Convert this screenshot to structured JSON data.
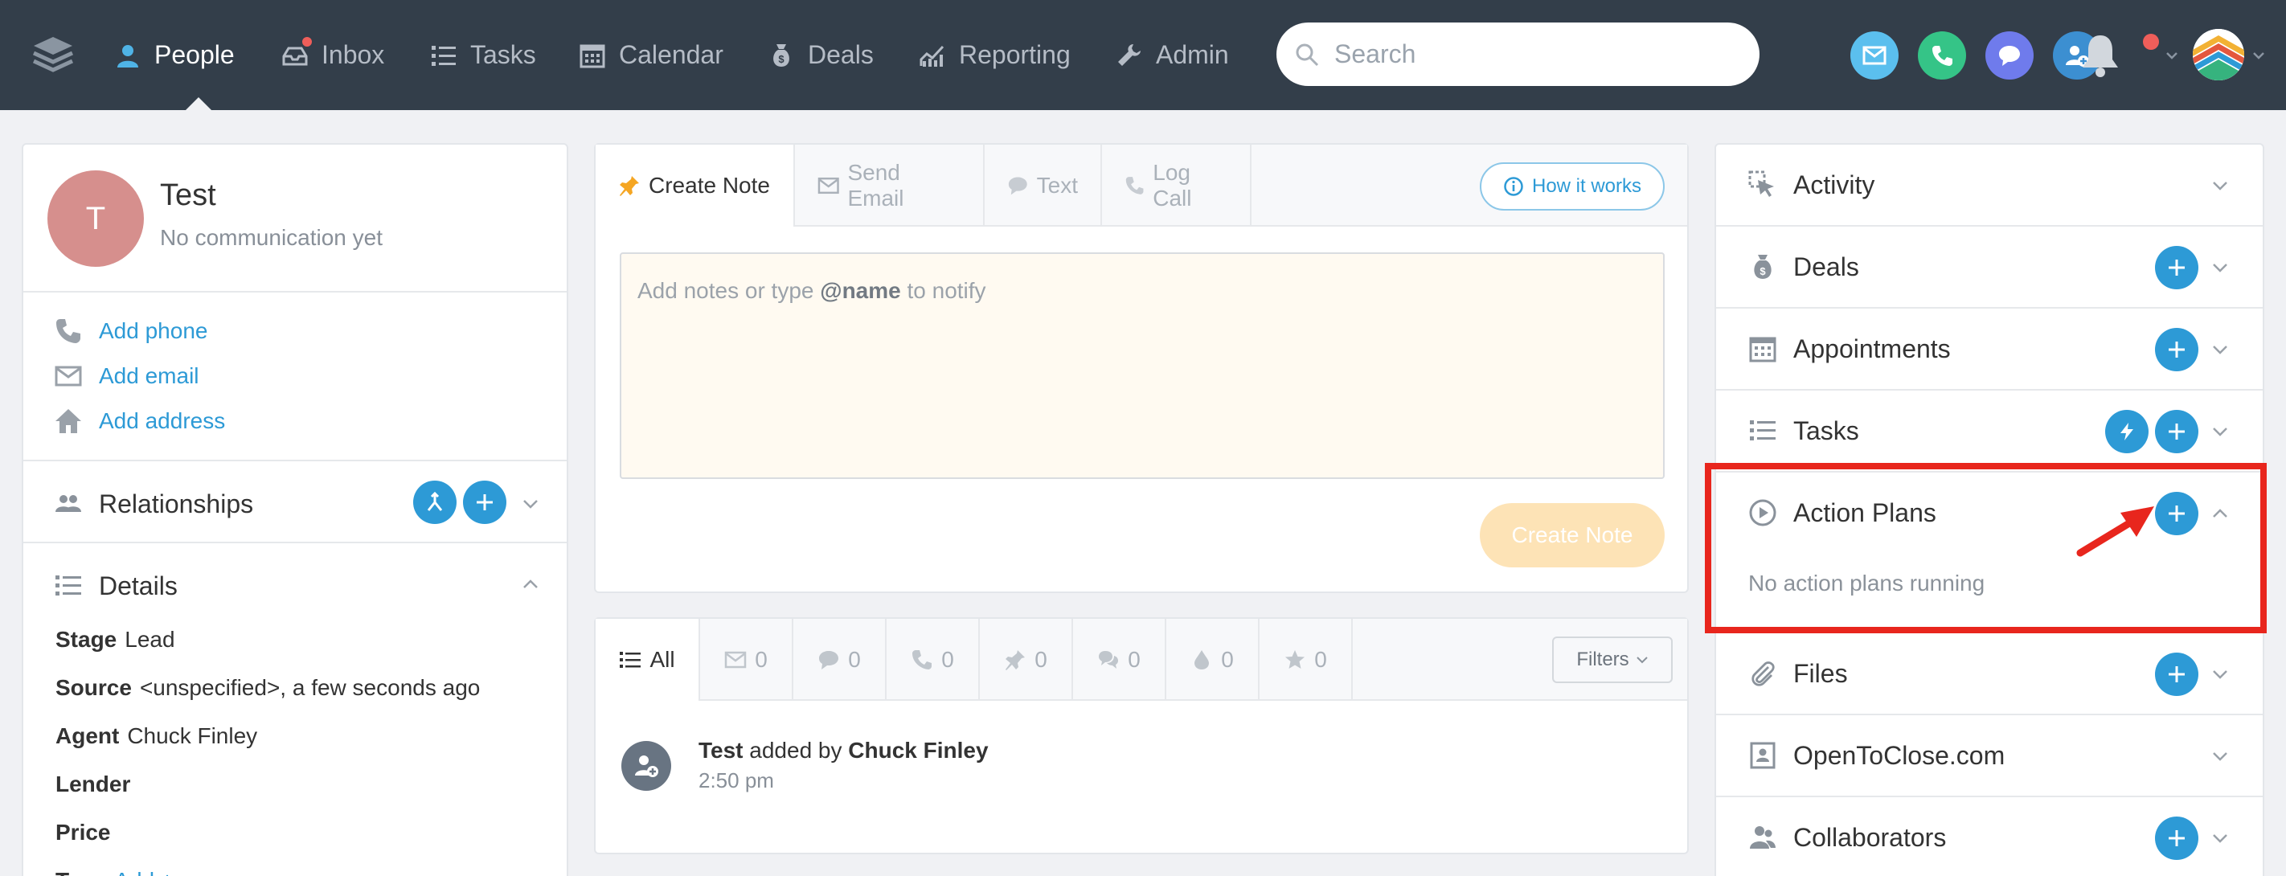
{
  "nav": {
    "items": [
      {
        "label": "People",
        "icon": "person-icon",
        "active": true
      },
      {
        "label": "Inbox",
        "icon": "inbox-icon",
        "active": false
      },
      {
        "label": "Tasks",
        "icon": "list-icon",
        "active": false
      },
      {
        "label": "Calendar",
        "icon": "calendar-icon",
        "active": false
      },
      {
        "label": "Deals",
        "icon": "money-bag-icon",
        "active": false
      },
      {
        "label": "Reporting",
        "icon": "chart-icon",
        "active": false
      },
      {
        "label": "Admin",
        "icon": "wrench-icon",
        "active": false
      }
    ],
    "search_placeholder": "Search",
    "colors": {
      "bg": "#333e4a",
      "accent": "#2d9ad6",
      "notify": "#ef5e5a"
    }
  },
  "profile": {
    "initial": "T",
    "name": "Test",
    "status": "No communication yet",
    "add_phone": "Add phone",
    "add_email": "Add email",
    "add_address": "Add address"
  },
  "relationships": {
    "title": "Relationships"
  },
  "details": {
    "title": "Details",
    "rows": [
      {
        "label": "Stage",
        "value": "Lead"
      },
      {
        "label": "Source",
        "value": "<unspecified>, a few seconds ago"
      },
      {
        "label": "Agent",
        "value": "Chuck Finley"
      },
      {
        "label": "Lender",
        "value": ""
      },
      {
        "label": "Price",
        "value": ""
      },
      {
        "label": "Tags",
        "value": "Add +"
      }
    ]
  },
  "compose": {
    "tabs": [
      "Create Note",
      "Send Email",
      "Text",
      "Log Call"
    ],
    "how_it_works": "How it works",
    "placeholder_pre": "Add notes or type ",
    "placeholder_bold": "@name",
    "placeholder_post": " to notify",
    "submit": "Create Note"
  },
  "timeline": {
    "filters": [
      {
        "label": "All",
        "icon": "list-icon"
      },
      {
        "label": "0",
        "icon": "envelope-icon"
      },
      {
        "label": "0",
        "icon": "chat-bubble-icon"
      },
      {
        "label": "0",
        "icon": "phone-icon"
      },
      {
        "label": "0",
        "icon": "pin-icon"
      },
      {
        "label": "0",
        "icon": "chat-bubbles-icon"
      },
      {
        "label": "0",
        "icon": "drop-icon"
      },
      {
        "label": "0",
        "icon": "star-icon"
      }
    ],
    "filters_button": "Filters",
    "entry_name": "Test",
    "entry_mid": " added by ",
    "entry_by": "Chuck Finley",
    "entry_time": "2:50 pm"
  },
  "right_panel": {
    "sections": [
      {
        "title": "Activity",
        "icon": "cursor-icon"
      },
      {
        "title": "Deals",
        "icon": "money-bag-icon"
      },
      {
        "title": "Appointments",
        "icon": "calendar-icon"
      },
      {
        "title": "Tasks",
        "icon": "list-icon"
      },
      {
        "title": "Action Plans",
        "icon": "play-circle-icon"
      },
      {
        "title": "Files",
        "icon": "paperclip-icon"
      },
      {
        "title": "OpenToClose.com",
        "icon": "contact-card-icon"
      },
      {
        "title": "Collaborators",
        "icon": "people-icon"
      }
    ],
    "action_plans_empty": "No action plans running"
  }
}
